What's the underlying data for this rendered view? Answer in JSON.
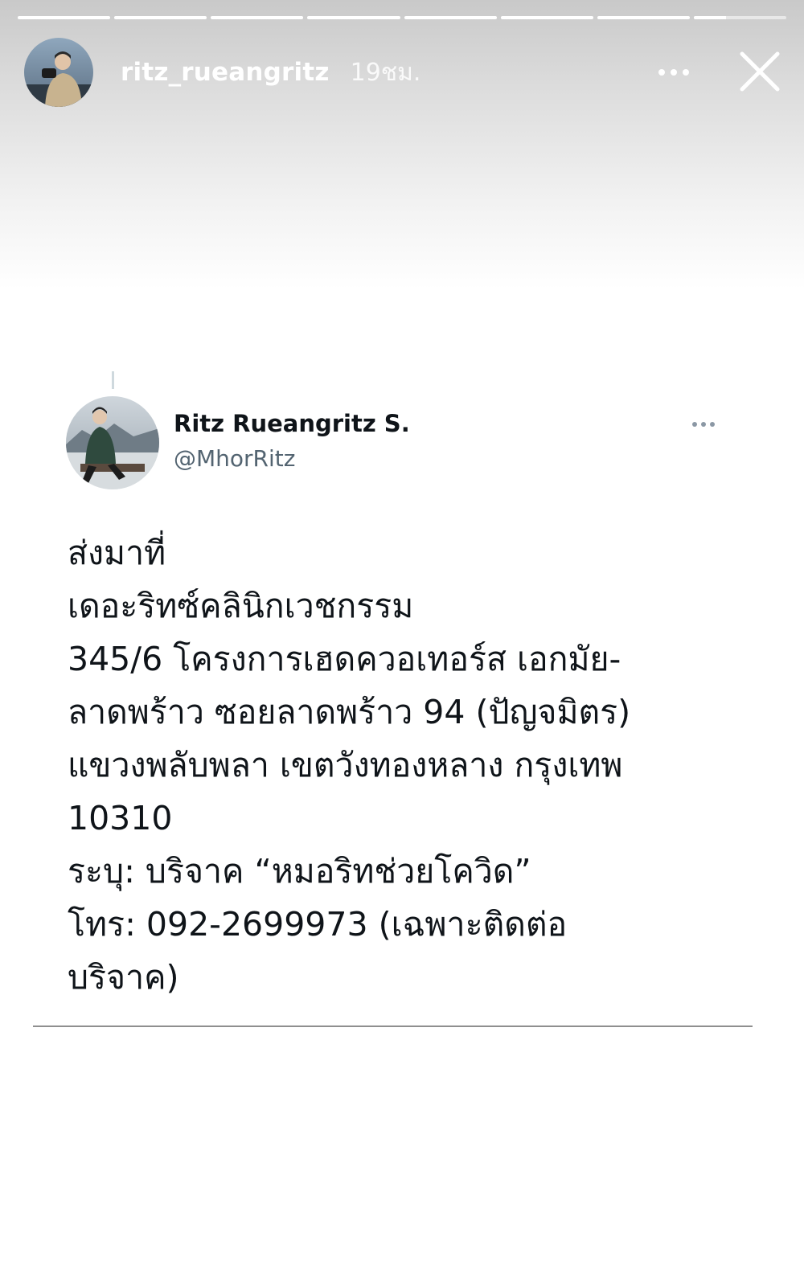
{
  "story": {
    "progress_segments": [
      1,
      1,
      1,
      1,
      1,
      1,
      1,
      0.35
    ],
    "username": "ritz_rueangritz",
    "time": "19ชม.",
    "more_icon": "more-horizontal-icon",
    "close_icon": "close-icon"
  },
  "tweet": {
    "display_name": "Ritz Rueangritz S.",
    "handle": "@MhorRitz",
    "more_icon": "more-horizontal-icon",
    "lines": [
      "ส่งมาที่",
      "เดอะริทซ์คลินิกเวชกรรม",
      "345/6 โครงการเฮดควอเทอร์ส เอกมัย-",
      "ลาดพร้าว ซอยลาดพร้าว 94 (ปัญจมิตร)",
      "แขวงพลับพลา เขตวังทองหลาง กรุงเทพ",
      "10310",
      "ระบุ: บริจาค “หมอริทช่วยโควิด”",
      "โทร: 092-2699973 (เฉพาะติดต่อ",
      "บริจาค)"
    ]
  },
  "colors": {
    "name": "#0f1419",
    "handle": "#536471",
    "divider": "#8f8f8f"
  }
}
